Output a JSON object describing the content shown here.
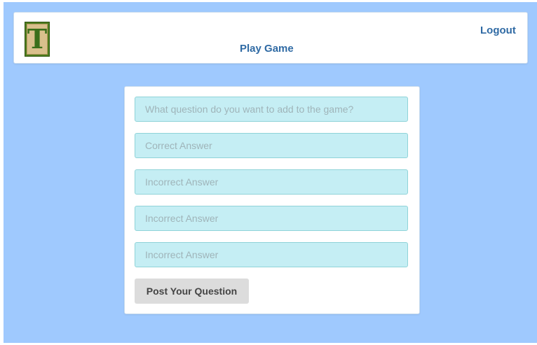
{
  "header": {
    "logo_letter": "T",
    "play_game_label": "Play Game",
    "logout_label": "Logout"
  },
  "form": {
    "question_placeholder": "What question do you want to add to the game?",
    "correct_placeholder": "Correct Answer",
    "incorrect_1_placeholder": "Incorrect Answer",
    "incorrect_2_placeholder": "Incorrect Answer",
    "incorrect_3_placeholder": "Incorrect Answer",
    "submit_label": "Post Your Question"
  },
  "colors": {
    "page_background": "#9fc9fe",
    "link": "#2f6aa4",
    "input_background": "#c5eef4",
    "button_background": "#dcdcdc",
    "logo_frame": "#4f7d1f"
  }
}
